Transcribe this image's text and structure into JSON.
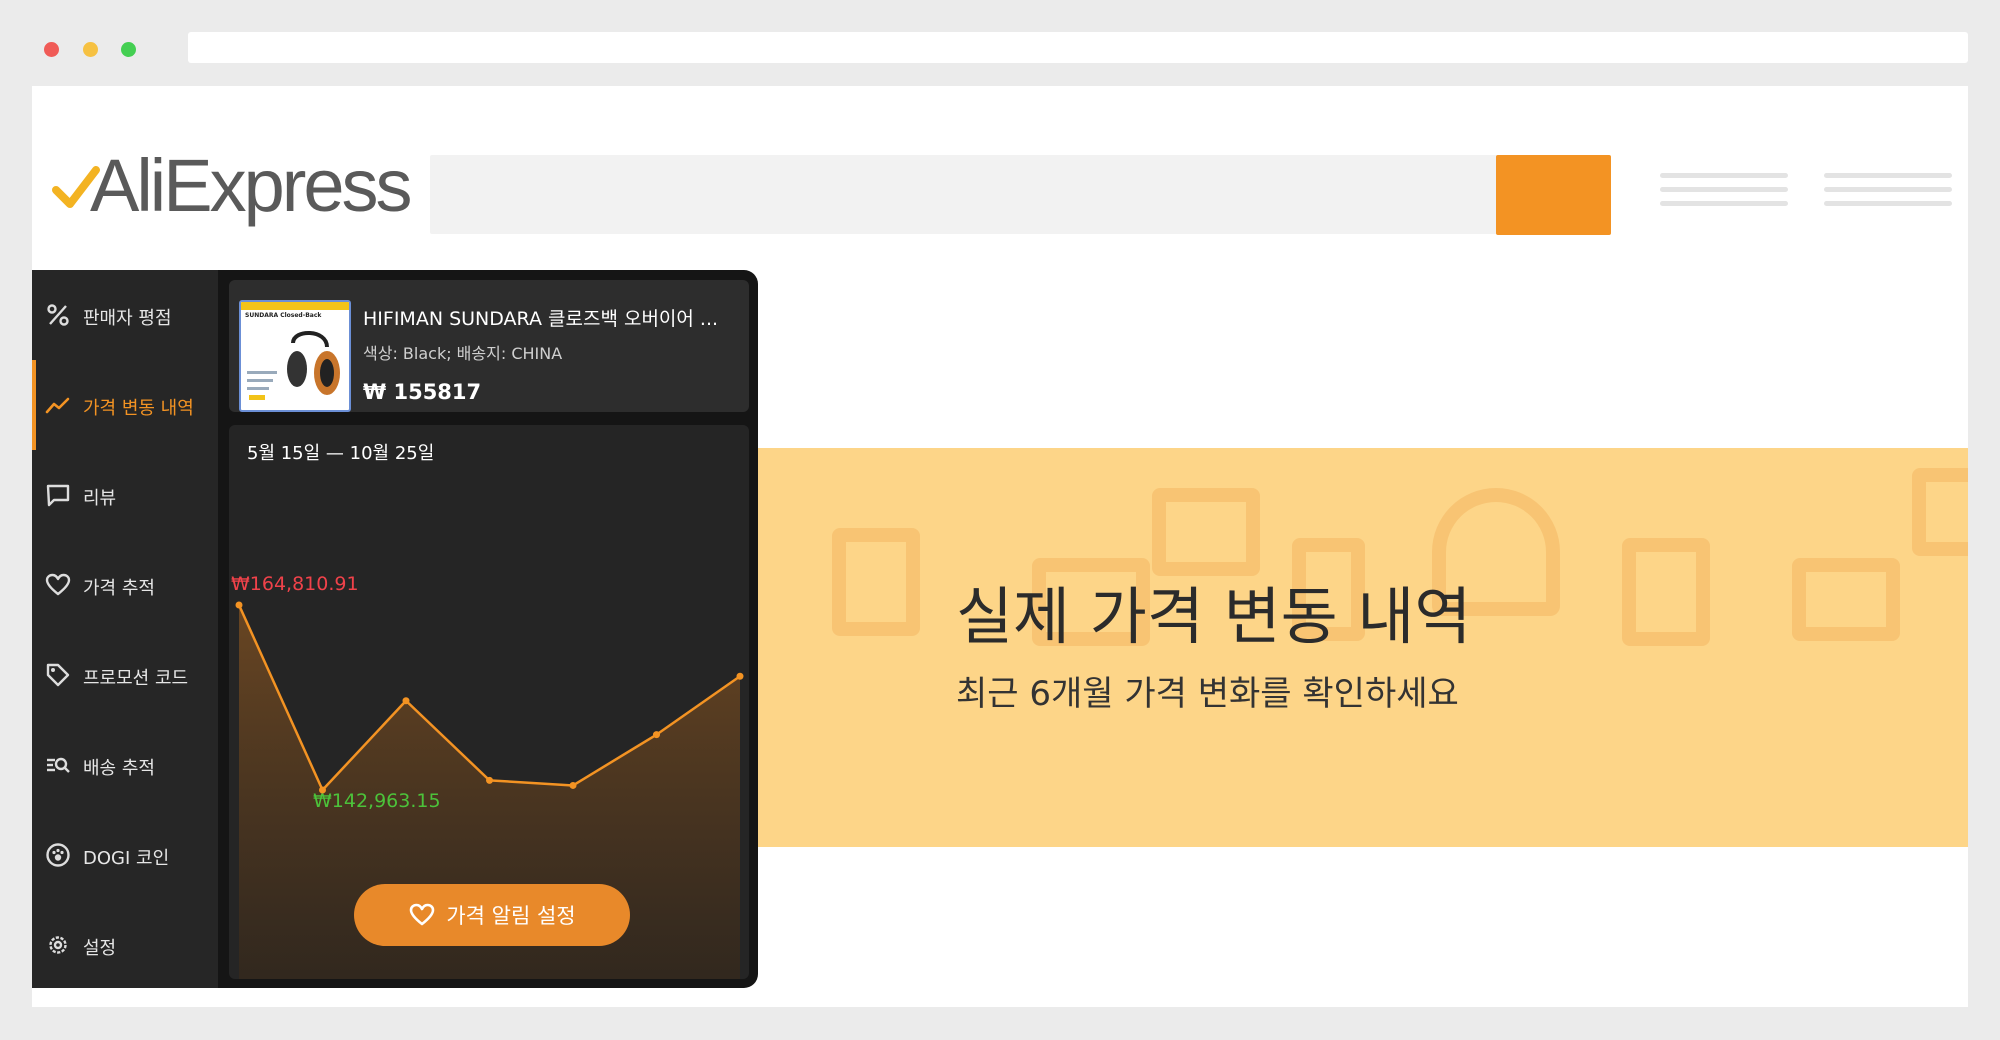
{
  "window": {
    "controls": [
      "close",
      "minimize",
      "maximize"
    ]
  },
  "header": {
    "logo_text": "AliExpress",
    "search_placeholder": "",
    "search_icon": "none",
    "menu_icons": [
      "menu-lines-icon",
      "menu-lines-icon"
    ]
  },
  "sidebar": {
    "items": [
      {
        "label": "판매자 평점",
        "icon": "percent-icon",
        "active": false
      },
      {
        "label": "가격 변동 내역",
        "icon": "trend-icon",
        "active": true
      },
      {
        "label": "리뷰",
        "icon": "comment-icon",
        "active": false
      },
      {
        "label": "가격 추적",
        "icon": "heart-icon",
        "active": false
      },
      {
        "label": "프로모션 코드",
        "icon": "tag-icon",
        "active": false
      },
      {
        "label": "배송 추적",
        "icon": "delivery-search-icon",
        "active": false
      },
      {
        "label": "DOGI 코인",
        "icon": "paw-coin-icon",
        "active": false
      },
      {
        "label": "설정",
        "icon": "gear-icon",
        "active": false
      }
    ]
  },
  "product": {
    "title": "HIFIMAN SUNDARA 클로즈백 오버이어 ...",
    "options": "색상: Black; 배송지: CHINA",
    "price": "₩ 155817",
    "thumb_caption": "SUNDARA Closed-Back"
  },
  "price_chart": {
    "range": "5월 15일 — 10월 25일",
    "max_label": "₩164,810.91",
    "min_label": "₩142,963.15",
    "alert_button": "가격 알림 설정"
  },
  "chart_data": {
    "type": "area",
    "title": "",
    "x": [
      1,
      2,
      3,
      4,
      5,
      6,
      7
    ],
    "series": [
      {
        "values": [
          164810.91,
          142963.15,
          153500,
          144100,
          143500,
          149500,
          156400
        ]
      }
    ],
    "colors": {
      "line": "#f39323",
      "fill": "#5a3a1a"
    },
    "grid": false
  },
  "banner": {
    "title": "실제 가격 변동 내역",
    "subtitle": "최근 6개월 가격 변화를 확인하세요"
  },
  "colors": {
    "accent": "#f39323",
    "banner_bg": "#fdd588",
    "panel_bg": "#262626"
  }
}
